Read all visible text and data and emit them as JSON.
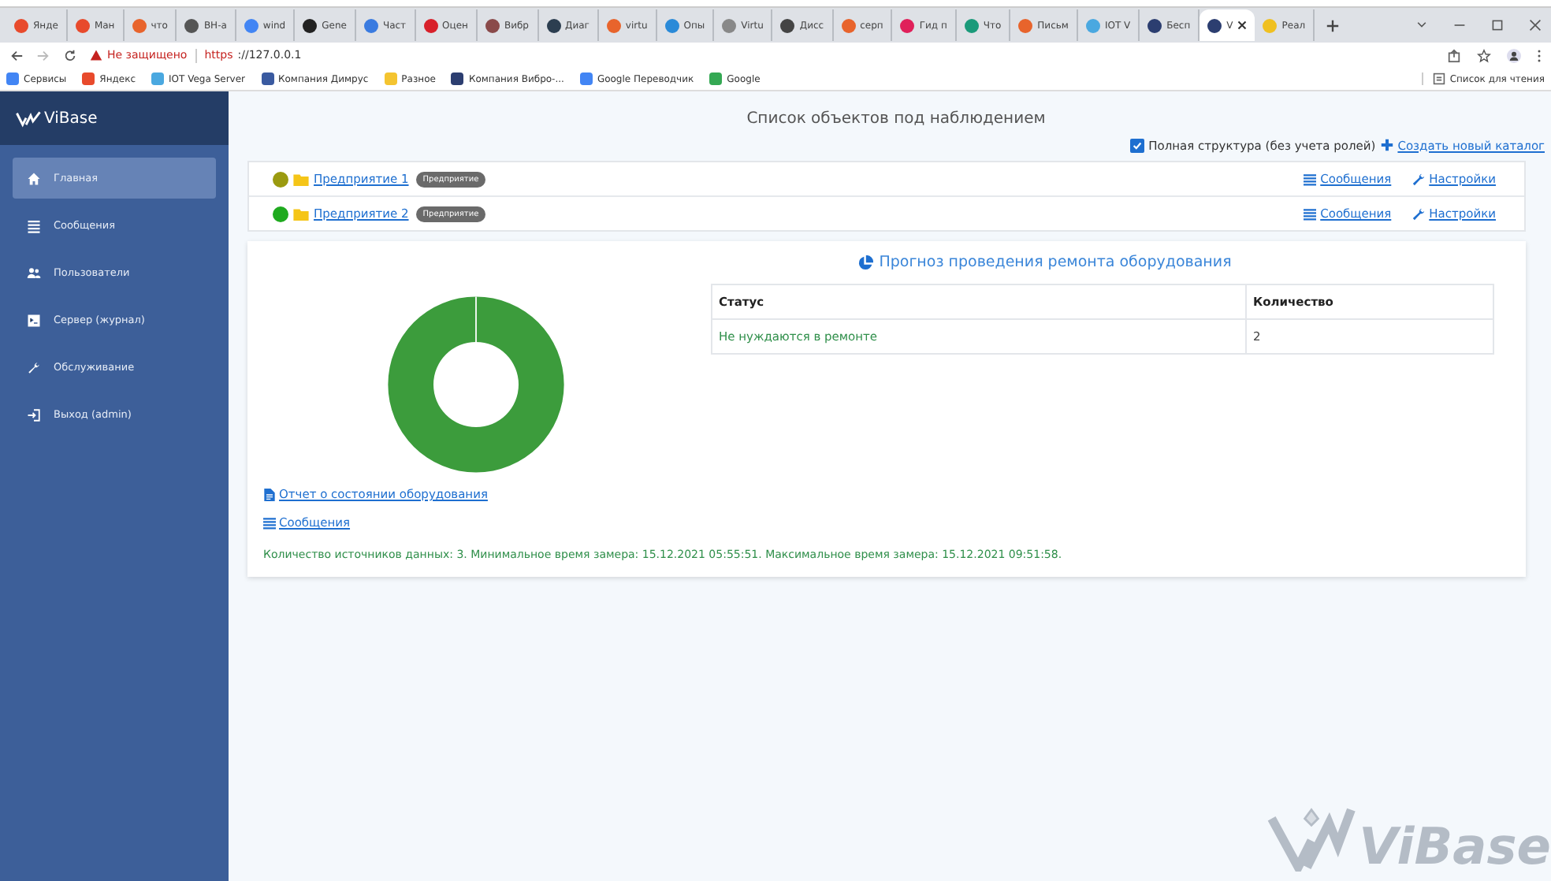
{
  "browser": {
    "tabs": [
      {
        "label": "Янде",
        "color": "#e84a2c",
        "selected": false
      },
      {
        "label": "Ман",
        "color": "#e84a2c",
        "selected": false
      },
      {
        "label": "что",
        "color": "#e8642c",
        "selected": false
      },
      {
        "label": "BH-a",
        "color": "#555555",
        "selected": false
      },
      {
        "label": "wind",
        "color": "#4285f4",
        "selected": false
      },
      {
        "label": "Gene",
        "color": "#222222",
        "selected": false
      },
      {
        "label": "Част",
        "color": "#3a7be0",
        "selected": false
      },
      {
        "label": "Оцен",
        "color": "#d8202a",
        "selected": false
      },
      {
        "label": "Вибр",
        "color": "#8a4a4a",
        "selected": false
      },
      {
        "label": "Диаг",
        "color": "#2c3e50",
        "selected": false
      },
      {
        "label": "virtu",
        "color": "#e8642c",
        "selected": false
      },
      {
        "label": "Опы",
        "color": "#2a8ad8",
        "selected": false
      },
      {
        "label": "Virtu",
        "color": "#888888",
        "selected": false
      },
      {
        "label": "Дисс",
        "color": "#444444",
        "selected": false
      },
      {
        "label": "серп",
        "color": "#e8642c",
        "selected": false
      },
      {
        "label": "Гид п",
        "color": "#e0205a",
        "selected": false
      },
      {
        "label": "Что",
        "color": "#1a9a7a",
        "selected": false
      },
      {
        "label": "Письм",
        "color": "#e8642c",
        "selected": false
      },
      {
        "label": "IOT V",
        "color": "#4aa8e0",
        "selected": false
      },
      {
        "label": "Бесп",
        "color": "#2c3e70",
        "selected": false
      },
      {
        "label": "V",
        "color": "#2c3e70",
        "selected": true
      },
      {
        "label": "Реал",
        "color": "#f0c020",
        "selected": false
      }
    ],
    "not_secure": "Не защищено",
    "url_scheme": "https",
    "url_rest": "://127.0.0.1",
    "bookmarks": [
      {
        "label": "Сервисы",
        "color": "#4285f4"
      },
      {
        "label": "Яндекс",
        "color": "#e84a2c"
      },
      {
        "label": "IOT Vega Server",
        "color": "#4aa8e0"
      },
      {
        "label": "Компания Димрус",
        "color": "#3a5aa0"
      },
      {
        "label": "Разное",
        "color": "#f4c430"
      },
      {
        "label": "Компания Вибро-...",
        "color": "#2c3e70"
      },
      {
        "label": "Google Переводчик",
        "color": "#4285f4"
      },
      {
        "label": "Google",
        "color": "#34a853"
      }
    ],
    "reading_list": "Список для чтения"
  },
  "sidebar": {
    "logo": "ViBase",
    "items": [
      {
        "label": "Главная",
        "kind": "home",
        "selected": true
      },
      {
        "label": "Сообщения",
        "kind": "list",
        "selected": false
      },
      {
        "label": "Пользователи",
        "kind": "users",
        "selected": false
      },
      {
        "label": "Сервер (журнал)",
        "kind": "terminal",
        "selected": false
      },
      {
        "label": "Обслуживание",
        "kind": "wrench",
        "selected": false
      },
      {
        "label": "Выход (admin)",
        "kind": "exit",
        "selected": false
      }
    ]
  },
  "page": {
    "title": "Список объектов под наблюдением",
    "full_structure": {
      "label": "Полная структура (без учета ролей)",
      "checked": true
    },
    "create_link": "Создать новый каталог",
    "objects": [
      {
        "name": "Предприятие 1",
        "tag": "Предприятие",
        "color": "#9a9a10",
        "links": [
          "Сообщения",
          "Настройки"
        ]
      },
      {
        "name": "Предприятие 2",
        "tag": "Предприятие",
        "color": "#1faa1f",
        "links": [
          "Сообщения",
          "Настройки"
        ]
      }
    ],
    "forecast": {
      "title": "Прогноз проведения ремонта оборудования",
      "table": {
        "columns": [
          "Статус",
          "Количество"
        ],
        "rows": [
          [
            "Не нуждаются в ремонте",
            "2"
          ]
        ]
      },
      "report_link": "Отчет о состоянии оборудования",
      "messages_link": "Сообщения",
      "summary": "Количество источников данных: 3. Минимальное время замера: 15.12.2021 05:55:51. Максимальное время замера: 15.12.2021 09:51:58."
    },
    "brand": "ViBase"
  }
}
